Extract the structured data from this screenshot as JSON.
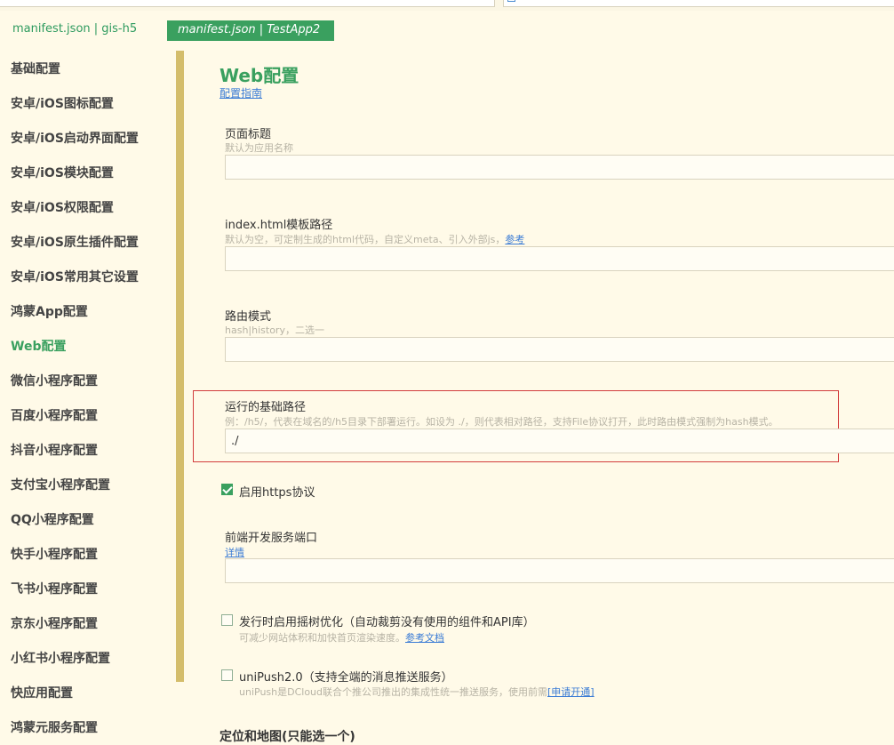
{
  "tabs": [
    {
      "label": "manifest.json | gis-h5",
      "active": false
    },
    {
      "label": "manifest.json | TestApp2",
      "active": true
    }
  ],
  "sidebar": {
    "items": [
      {
        "label": "基础配置",
        "active": false
      },
      {
        "label": "安卓/iOS图标配置",
        "active": false
      },
      {
        "label": "安卓/iOS启动界面配置",
        "active": false
      },
      {
        "label": "安卓/iOS模块配置",
        "active": false
      },
      {
        "label": "安卓/iOS权限配置",
        "active": false
      },
      {
        "label": "安卓/iOS原生插件配置",
        "active": false
      },
      {
        "label": "安卓/iOS常用其它设置",
        "active": false
      },
      {
        "label": "鸿蒙App配置",
        "active": false
      },
      {
        "label": "Web配置",
        "active": true
      },
      {
        "label": "微信小程序配置",
        "active": false
      },
      {
        "label": "百度小程序配置",
        "active": false
      },
      {
        "label": "抖音小程序配置",
        "active": false
      },
      {
        "label": "支付宝小程序配置",
        "active": false
      },
      {
        "label": "QQ小程序配置",
        "active": false
      },
      {
        "label": "快手小程序配置",
        "active": false
      },
      {
        "label": "飞书小程序配置",
        "active": false
      },
      {
        "label": "京东小程序配置",
        "active": false
      },
      {
        "label": "小红书小程序配置",
        "active": false
      },
      {
        "label": "快应用配置",
        "active": false
      },
      {
        "label": "鸿蒙元服务配置",
        "active": false
      }
    ]
  },
  "main": {
    "title": "Web配置",
    "guide_link": "配置指南",
    "page_title": {
      "label": "页面标题",
      "hint": "默认为应用名称",
      "value": ""
    },
    "template_path": {
      "label": "index.html模板路径",
      "hint": "默认为空，可定制生成的html代码，自定义meta、引入外部js，",
      "hint_link": "参考",
      "value": ""
    },
    "router_mode": {
      "label": "路由模式",
      "hint": "hash|history，二选一",
      "value": ""
    },
    "base_path": {
      "label": "运行的基础路径",
      "hint": "例：/h5/，代表在域名的/h5目录下部署运行。如设为 ./，则代表相对路径，支持File协议打开，此时路由模式强制为hash模式。",
      "value": "./"
    },
    "https": {
      "label": "启用https协议",
      "checked": true
    },
    "dev_port": {
      "label": "前端开发服务端口",
      "link": "详情",
      "value": ""
    },
    "treeshake": {
      "label": "发行时启用摇树优化（自动裁剪没有使用的组件和API库）",
      "checked": false,
      "hint": "可减少网站体积和加快首页渲染速度。",
      "hint_link": "参考文档"
    },
    "unipush": {
      "label": "uniPush2.0（支持全端的消息推送服务）",
      "checked": false,
      "hint": "uniPush是DCloud联合个推公司推出的集成性统一推送服务，使用前需",
      "hint_link": "[申请开通]"
    },
    "section_title": "定位和地图(只能选一个)"
  },
  "colors": {
    "accent": "#3aa05f",
    "highlight_border": "#d23c3c",
    "link": "#3a7bd5",
    "scrollbar": "#d4bd6b"
  }
}
